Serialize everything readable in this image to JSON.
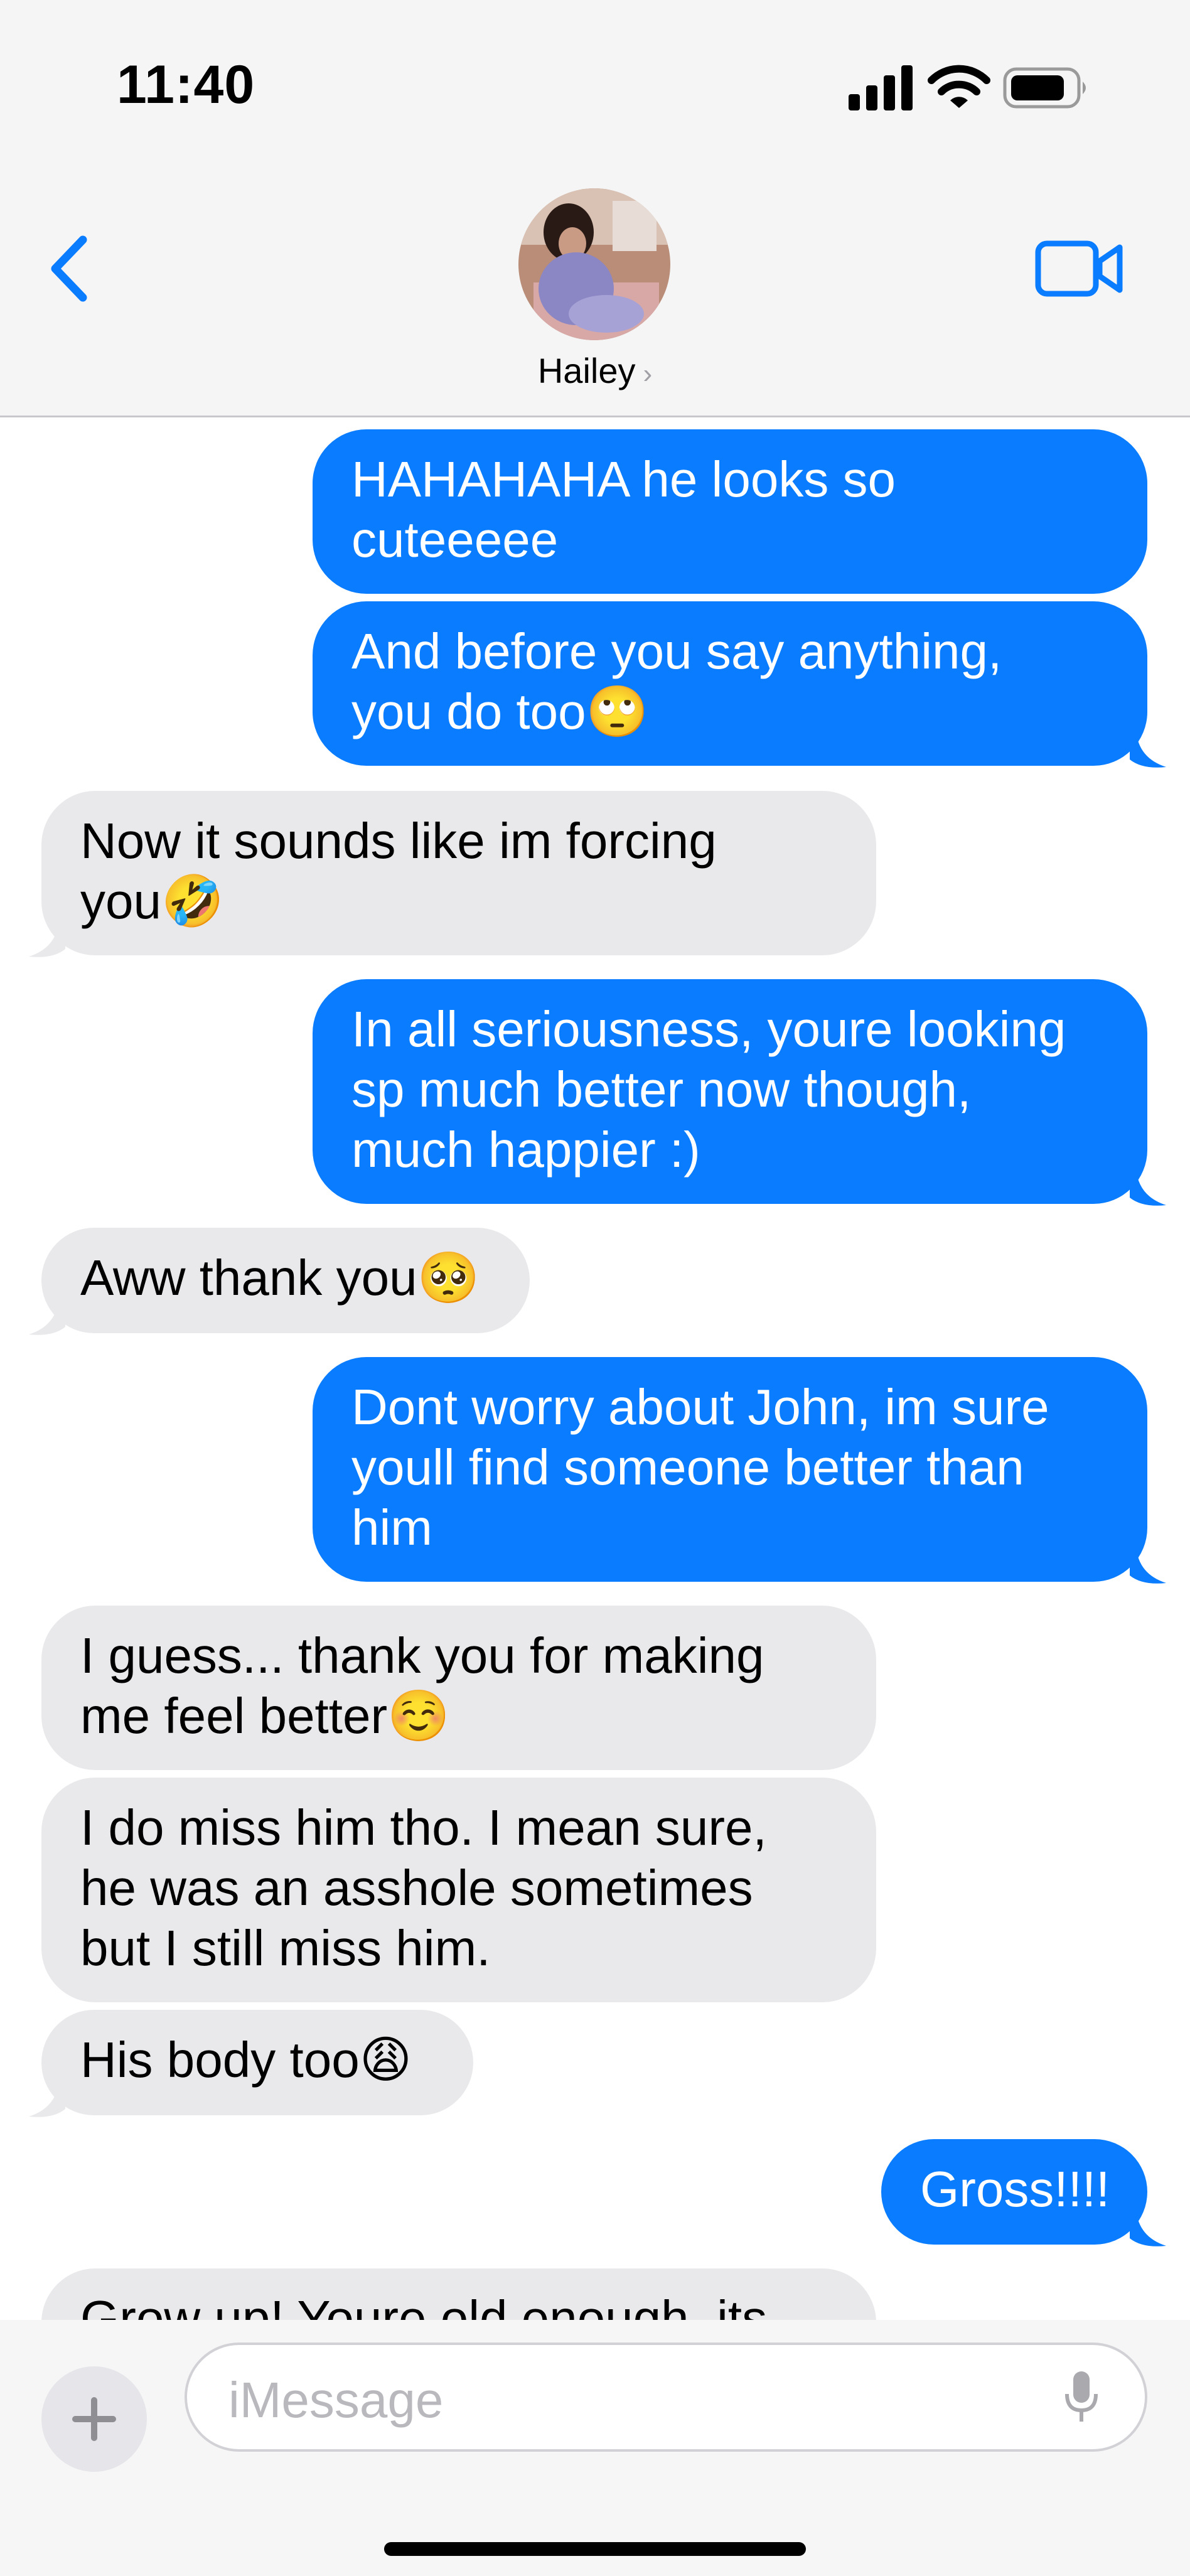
{
  "status_bar": {
    "time": "11:40"
  },
  "header": {
    "contact_name": "Hailey",
    "chevron": "›"
  },
  "colors": {
    "outgoing": "#0a7cff",
    "incoming": "#e9e9eb",
    "accent": "#0a7cff"
  },
  "icons": {
    "back": "chevron-left-icon",
    "video": "video-camera-icon",
    "plus": "plus-icon",
    "mic": "microphone-icon"
  },
  "messages": [
    {
      "dir": "out",
      "text": "HAHAHAHA he looks so\ncuteeeee"
    },
    {
      "dir": "out",
      "text": "And before you say anything,\nyou do too🙄"
    },
    {
      "dir": "in",
      "text": "Now it sounds like im forcing\nyou🤣"
    },
    {
      "dir": "out",
      "text": "In all seriousness, youre looking\nsp much better now though,\nmuch happier :)"
    },
    {
      "dir": "in",
      "text": "Aww thank you🥺"
    },
    {
      "dir": "out",
      "text": "Dont worry about John, im sure\nyoull find someone better than\nhim"
    },
    {
      "dir": "in",
      "text": "I guess... thank you for making\nme feel better☺️"
    },
    {
      "dir": "in",
      "text": "I do miss him tho. I mean sure,\nhe was an asshole sometimes\nbut I still miss him."
    },
    {
      "dir": "in",
      "text": "His body too😩"
    },
    {
      "dir": "out",
      "text": "Gross!!!!"
    },
    {
      "dir": "in",
      "text": "Grow up! Youre old enough, its"
    }
  ],
  "input": {
    "placeholder": "iMessage"
  }
}
